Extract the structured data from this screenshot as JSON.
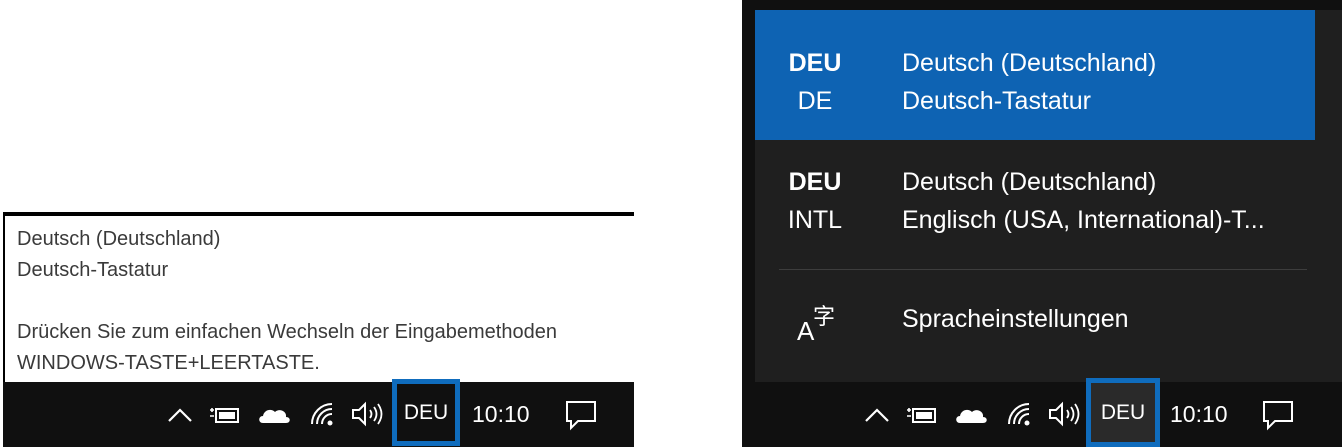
{
  "tooltip": {
    "language_name": "Deutsch (Deutschland)",
    "keyboard_name": "Deutsch-Tastatur",
    "hint_line1": "Drücken Sie zum einfachen Wechseln der Eingabemethoden",
    "hint_line2": "WINDOWS-TASTE+LEERTASTE."
  },
  "taskbar_left": {
    "language_indicator": "DEU",
    "clock": "10:10",
    "icons": [
      "chevron-up-icon",
      "battery-charging-icon",
      "onedrive-cloud-icon",
      "wifi-icon",
      "speaker-icon",
      "action-center-icon"
    ]
  },
  "language_flyout": {
    "items": [
      {
        "code": "DEU",
        "keyboard_code": "DE",
        "language": "Deutsch (Deutschland)",
        "keyboard": "Deutsch-Tastatur",
        "selected": true
      },
      {
        "code": "DEU",
        "keyboard_code": "INTL",
        "language": "Deutsch (Deutschland)",
        "keyboard": "Englisch (USA, International)-T...",
        "selected": false
      }
    ],
    "settings_label": "Spracheinstellungen",
    "settings_icon": "language-settings-icon"
  },
  "taskbar_right": {
    "language_indicator": "DEU",
    "clock": "10:10"
  },
  "colors": {
    "accent": "#0e63b3",
    "highlight_border": "#0f6cbd",
    "taskbar": "#101010",
    "flyout": "#1f1f1f"
  }
}
